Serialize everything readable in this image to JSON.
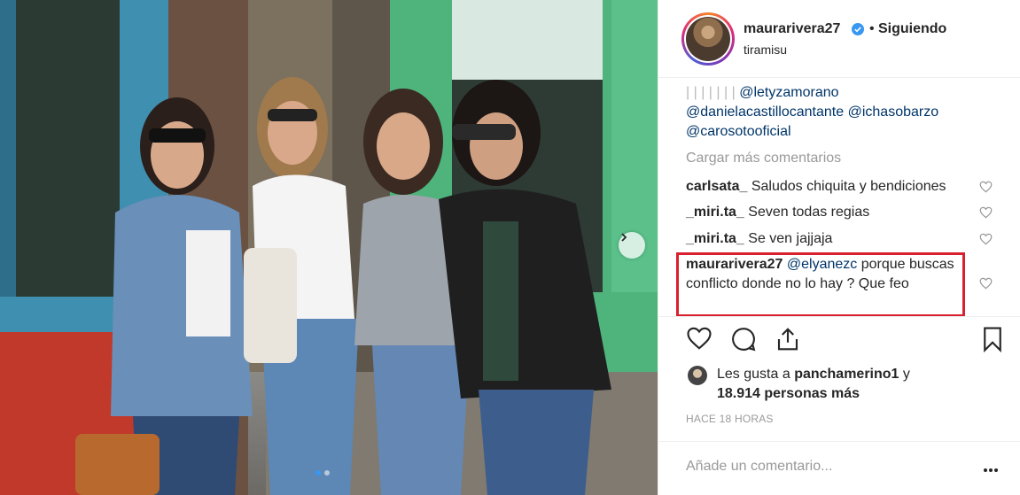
{
  "post": {
    "username": "maurarivera27",
    "follow_separator": "•",
    "follow_status": "Siguiendo",
    "location": "tiramisu"
  },
  "caption_tail": {
    "pipes": "| | | | | | | ",
    "mention_1": "@letyzamorano",
    "mention_2": "@danielacastillocantante",
    "mention_3": "@ichasobarzo",
    "mention_4": "@carosotooficial"
  },
  "load_more_label": "Cargar más comentarios",
  "comments": [
    {
      "user": "carlsata_",
      "text": "Saludos chiquita y bendiciones"
    },
    {
      "user": "_miri.ta_",
      "text": "Seven todas regias"
    },
    {
      "user": "_miri.ta_",
      "text": "Se ven jajjaja"
    },
    {
      "user": "maurarivera27",
      "mention": "@elyanezc",
      "text": "porque buscas conflicto donde no lo hay ? Que feo"
    }
  ],
  "likes": {
    "prefix": "Les gusta a",
    "first_liker": "panchamerino1",
    "connector": "y",
    "others": "18.914 personas más"
  },
  "timestamp": "HACE 18 HORAS",
  "add_comment": {
    "placeholder": "Añade un comentario..."
  },
  "colors": {
    "highlight_box": "#d8202f",
    "verified_badge": "#3897f0",
    "mention": "#003569",
    "muted": "#999999",
    "active_dot": "#3897f0"
  },
  "icons": {
    "verified": "verified-badge-icon",
    "like": "heart-icon",
    "comment": "comment-bubble-icon",
    "share": "share-icon",
    "save": "bookmark-icon",
    "next": "chevron-right-icon",
    "more": "more-dots-icon"
  },
  "carousel": {
    "slides": 2,
    "active_slide": 1
  }
}
